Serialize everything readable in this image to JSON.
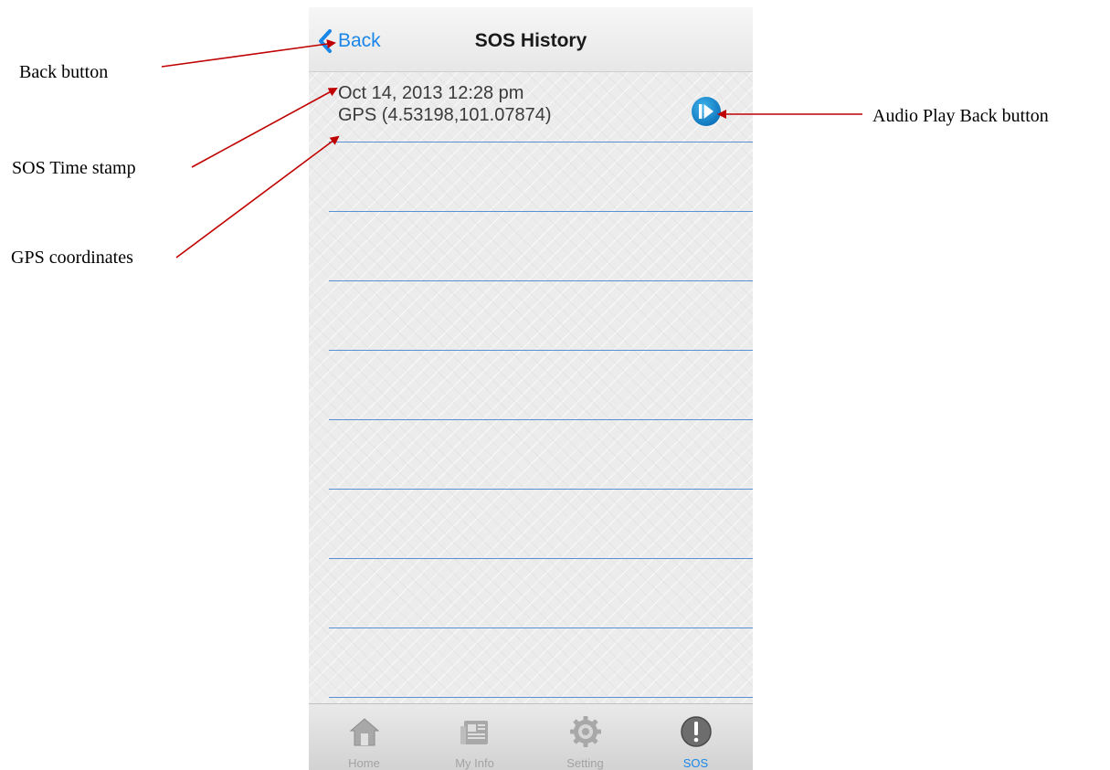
{
  "navbar": {
    "back_label": "Back",
    "title": "SOS History"
  },
  "sos_entries": [
    {
      "timestamp": "Oct 14, 2013  12:28 pm",
      "gps": "GPS (4.53198,101.07874)"
    }
  ],
  "tabs": [
    {
      "label": "Home",
      "icon": "home-icon"
    },
    {
      "label": "My Info",
      "icon": "newspaper-icon"
    },
    {
      "label": "Setting",
      "icon": "gear-icon"
    },
    {
      "label": "SOS",
      "icon": "exclamation-icon",
      "active": true
    }
  ],
  "annotations": {
    "back_button": "Back button",
    "timestamp": "SOS Time stamp",
    "gps": "GPS coordinates",
    "audio": "Audio Play Back button"
  },
  "colors": {
    "accent": "#1a86e8",
    "arrow": "#c00000",
    "rule": "#5a8fd6"
  }
}
